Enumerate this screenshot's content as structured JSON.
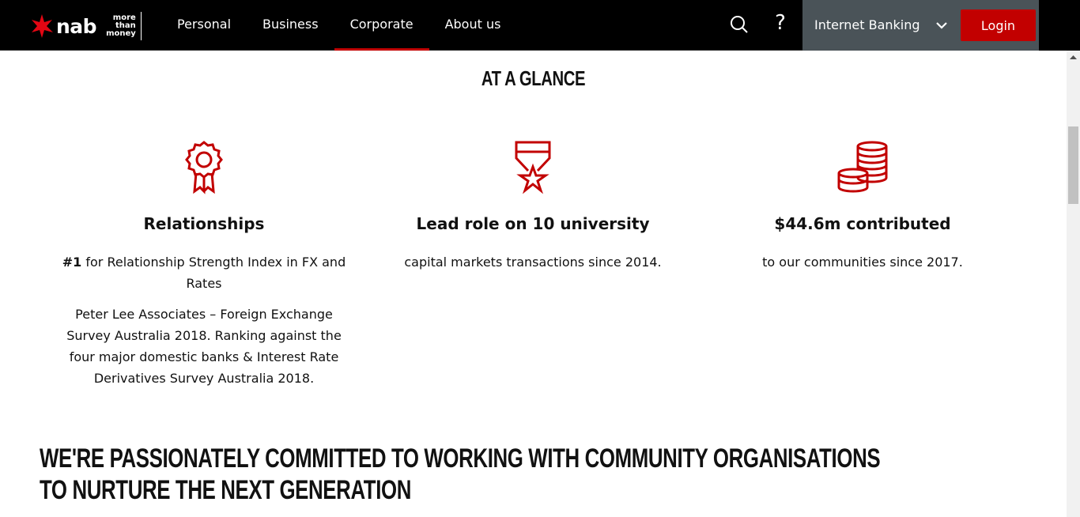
{
  "brand": {
    "name": "nab",
    "tagline_line1": "more",
    "tagline_line2": "than",
    "tagline_line3": "money",
    "accent": "#c20000",
    "header_bg": "#000000",
    "banking_bg": "#4a5358"
  },
  "nav": {
    "items": [
      {
        "label": "Personal"
      },
      {
        "label": "Business"
      },
      {
        "label": "Corporate"
      },
      {
        "label": "About us"
      }
    ],
    "active": "Corporate"
  },
  "header": {
    "search_icon": "search-icon",
    "help_icon": "question-icon",
    "help_symbol": "?",
    "banking_label": "Internet Banking",
    "login_label": "Login"
  },
  "glance": {
    "title": "AT A GLANCE",
    "columns": [
      {
        "icon": "award-ribbon-icon",
        "heading": "Relationships",
        "text_bold": "#1",
        "text": " for Relationship Strength Index in FX and Rates",
        "note": "Peter Lee Associates – Foreign Exchange Survey Australia 2018. Ranking against the four major domestic banks & Interest Rate Derivatives Survey Australia 2018."
      },
      {
        "icon": "medal-star-icon",
        "heading": "Lead role on 10 university",
        "text": "capital markets transactions since 2014."
      },
      {
        "icon": "coin-stacks-icon",
        "heading": "$44.6m contributed",
        "text": "to our communities since 2017."
      }
    ]
  },
  "community": {
    "heading": "WE'RE PASSIONATELY COMMITTED TO WORKING WITH COMMUNITY ORGANISATIONS TO NURTURE THE NEXT GENERATION"
  }
}
